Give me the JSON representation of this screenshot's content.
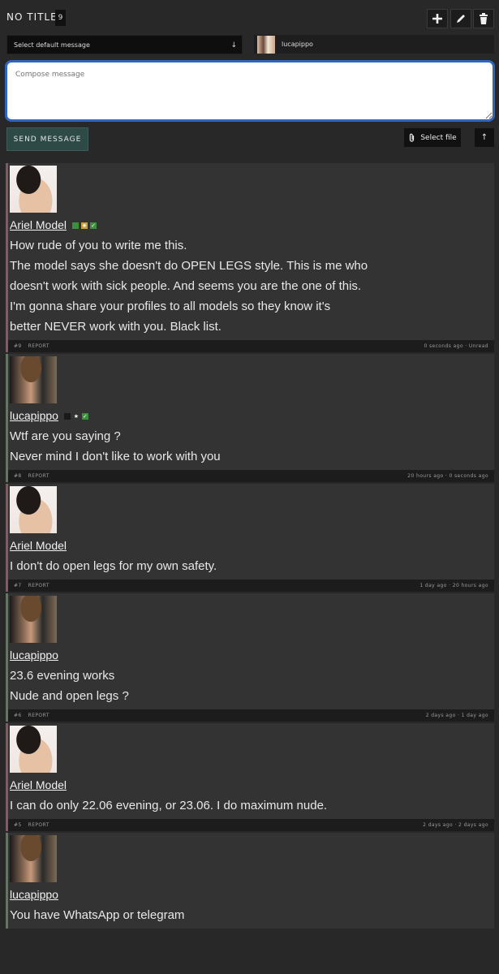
{
  "header": {
    "title": "NO TITLE",
    "count": "9"
  },
  "icons": {
    "add": "plus-icon",
    "edit": "pencil-icon",
    "delete": "trash-icon",
    "attach": "paperclip-icon",
    "up": "arrow-up-icon"
  },
  "default_message": {
    "selected": "Select default message"
  },
  "recipient": {
    "name": "lucapippo"
  },
  "compose": {
    "placeholder": "Compose message"
  },
  "actions": {
    "send_label": "SEND MESSAGE",
    "select_file_label": "Select file",
    "up_label": "↑"
  },
  "messages": [
    {
      "author": "Ariel Model",
      "lines": [
        "How rude of you to write me this.",
        "The model says she doesn't do OPEN LEGS style. This is me who",
        "doesn't work with sick people. And seems you are the one of this.",
        "I'm gonna share your profiles to all models so they know it's",
        "better NEVER work with you. Black list."
      ],
      "number": "#9",
      "report": "REPORT",
      "time": "0 seconds ago · Unread"
    },
    {
      "author": "lucapippo",
      "lines": [
        "Wtf are you saying ?",
        "Never mind I don't like to work with you"
      ],
      "number": "#8",
      "report": "REPORT",
      "time": "20 hours ago · 0 seconds ago"
    },
    {
      "author": "Ariel Model",
      "lines": [
        "I don't do open legs for my own safety."
      ],
      "number": "#7",
      "report": "REPORT",
      "time": "1 day ago · 20 hours ago"
    },
    {
      "author": "lucapippo",
      "lines": [
        "23.6 evening works",
        "Nude and open legs ?"
      ],
      "number": "#6",
      "report": "REPORT",
      "time": "2 days ago · 1 day ago"
    },
    {
      "author": "Ariel Model",
      "lines": [
        "I can do only 22.06 evening, or 23.06. I do maximum nude."
      ],
      "number": "#5",
      "report": "REPORT",
      "time": "2 days ago · 2 days ago"
    },
    {
      "author": "lucapippo",
      "lines": [
        "You have WhatsApp or telegram"
      ]
    }
  ]
}
